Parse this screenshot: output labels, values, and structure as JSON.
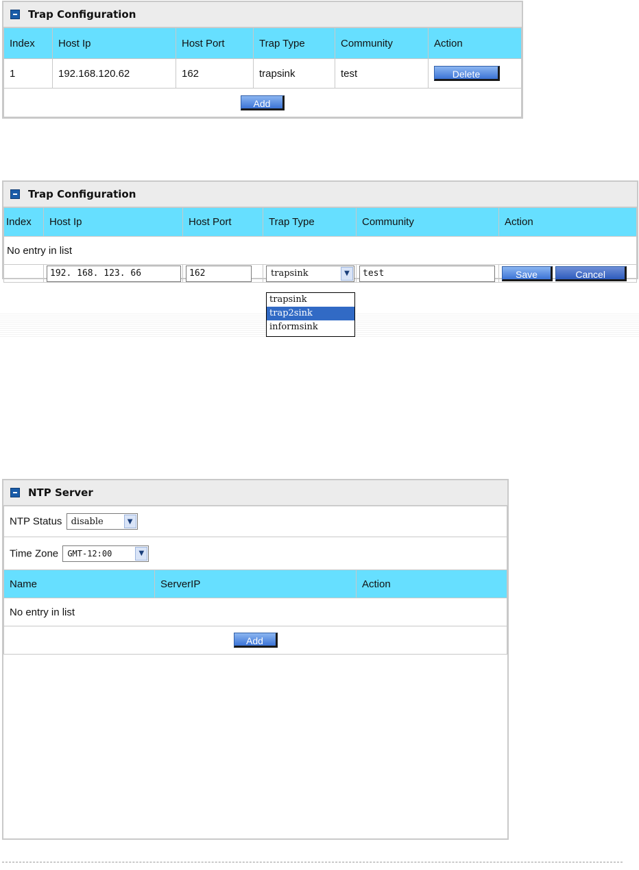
{
  "trap1": {
    "title": "Trap Configuration",
    "headers": [
      "Index",
      "Host Ip",
      "Host Port",
      "Trap Type",
      "Community",
      "Action"
    ],
    "row": {
      "index": "1",
      "host_ip": "192.168.120.62",
      "host_port": "162",
      "trap_type": "trapsink",
      "community": "test",
      "delete_label": "Delete"
    },
    "add_label": "Add"
  },
  "trap2": {
    "title": "Trap Configuration",
    "headers": [
      "Index",
      "Host Ip",
      "Host Port",
      "Trap Type",
      "Community",
      "Action"
    ],
    "empty_text": "No entry in list",
    "form": {
      "host_ip": "192. 168. 123. 66",
      "host_port": "162",
      "trap_type": "trapsink",
      "community": "test",
      "save_label": "Save",
      "cancel_label": "Cancel"
    },
    "dropdown_options": [
      "trapsink",
      "trap2sink",
      "informsink"
    ],
    "highlighted_option": "trap2sink"
  },
  "ntp": {
    "title": "NTP Server",
    "status_label": "NTP Status",
    "status_value": "disable",
    "timezone_label": "Time Zone",
    "timezone_value": "GMT-12:00",
    "headers": [
      "Name",
      "ServerIP",
      "Action"
    ],
    "empty_text": "No entry in list",
    "add_label": "Add"
  },
  "colors": {
    "header_row": "#66dfff",
    "title_bar": "#ececec",
    "button": "#3b73d6",
    "highlight": "#316ac5"
  },
  "icons": {
    "panel_icon": "panel-toggle-icon",
    "select_arrow": "chevron-down-icon"
  }
}
